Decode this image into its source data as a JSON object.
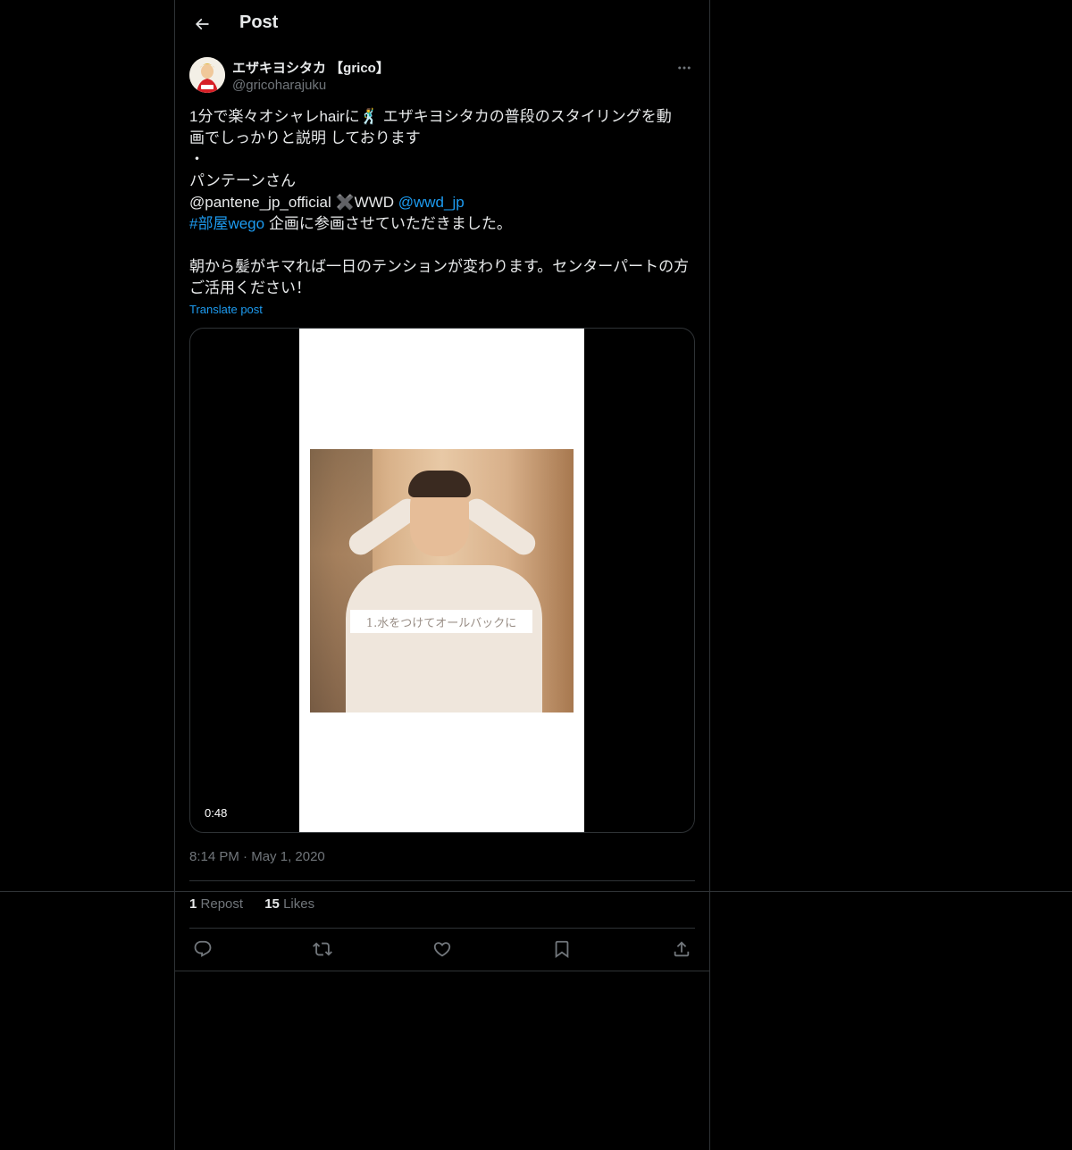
{
  "header": {
    "title": "Post"
  },
  "author": {
    "display_name": "エザキヨシタカ 【grico】",
    "handle": "@gricoharajuku",
    "avatar_label": "grico"
  },
  "post": {
    "line1": "1分で楽々オシャレhairに🕺 エザキヨシタカの普段のスタイリングを動",
    "line2": "画でしっかりと説明 しております",
    "line3": "・",
    "line4": "パンテーンさん",
    "line5_mention": "@pantene_jp_official",
    "line5_cross": "✖️",
    "line5_wwd": "WWD ",
    "line5_link": "@wwd_jp",
    "line6_hashtag": "#部屋wego",
    "line6_text": " 企画に参画させていただきました。",
    "line8": "朝から髪がキマれば一日のテンションが変わります。センターパートの方",
    "line9": "ご活用ください！",
    "translate": "Translate post"
  },
  "media": {
    "caption": "1.水をつけてオールバックに",
    "duration": "0:48"
  },
  "meta": {
    "time": "8:14 PM",
    "separator": "·",
    "date": "May 1, 2020"
  },
  "stats": {
    "reposts_count": "1",
    "reposts_label": "Repost",
    "likes_count": "15",
    "likes_label": "Likes"
  },
  "colors": {
    "background": "#000000",
    "text": "#e7e9ea",
    "muted": "#71767b",
    "link": "#1d9bf0",
    "border": "#2f3336"
  }
}
